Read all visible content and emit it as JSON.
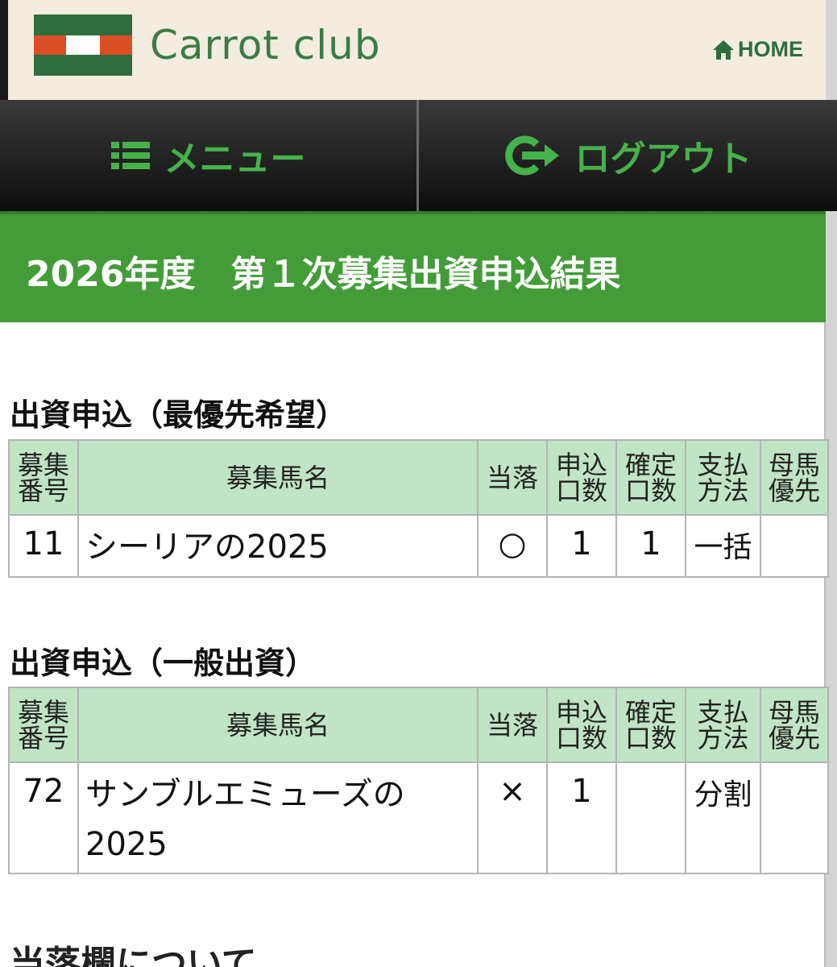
{
  "header": {
    "logo_text": "Carrot club",
    "home_label": "HOME"
  },
  "nav": {
    "menu_label": "メニュー",
    "logout_label": "ログアウト"
  },
  "page_title": "2026年度　第１次募集出資申込結果",
  "columns": {
    "number": [
      "募集",
      "番号"
    ],
    "horse_name": "募集馬名",
    "result": "当落",
    "applied": [
      "申込",
      "口数"
    ],
    "confirmed": [
      "確定",
      "口数"
    ],
    "payment": [
      "支払",
      "方法"
    ],
    "dam_priority": [
      "母馬",
      "優先"
    ]
  },
  "sections": [
    {
      "title": "出資申込（最優先希望）",
      "rows": [
        {
          "number": "11",
          "horse_name": "シーリアの2025",
          "result": "○",
          "applied": "1",
          "confirmed": "1",
          "payment": "一括",
          "dam_priority": ""
        }
      ]
    },
    {
      "title": "出資申込（一般出資）",
      "rows": [
        {
          "number": "72",
          "horse_name": "サンブルエミューズの2025",
          "result": "×",
          "applied": "1",
          "confirmed": "",
          "payment": "分割",
          "dam_priority": ""
        }
      ]
    }
  ],
  "footer_heading": "当落欄について",
  "colors": {
    "brand_green": "#449c39",
    "logo_green": "#2f6e3c",
    "logo_red": "#d94e25",
    "header_bg": "#f3ecdf",
    "table_header_bg": "#bfe4c6",
    "nav_text": "#46b24b"
  }
}
